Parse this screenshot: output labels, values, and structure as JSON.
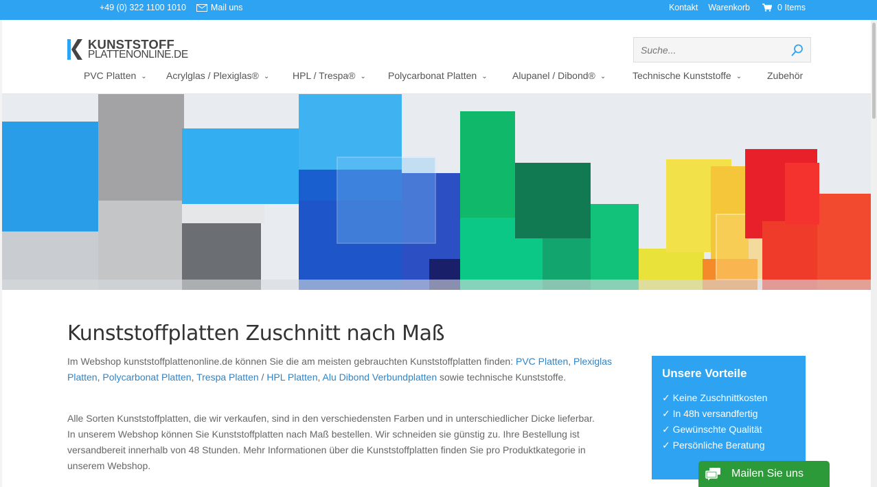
{
  "topbar": {
    "phone": "+49 (0) 322 1100 1010",
    "mail_label": "Mail uns",
    "links": [
      "Kontakt",
      "Warenkorb"
    ],
    "cart_label": "0 Items"
  },
  "logo": {
    "line1": "KUNSTSTOFF",
    "line2": "PLATTENONLINE.DE"
  },
  "search": {
    "placeholder": "Suche..."
  },
  "nav": [
    {
      "label": "PVC Platten",
      "chevron": "⌄"
    },
    {
      "label": "Acrylglas / Plexiglas®",
      "chevron": "⌄"
    },
    {
      "label": "HPL / Trespa®",
      "chevron": "⌄"
    },
    {
      "label": "Polycarbonat Platten",
      "chevron": "⌄"
    },
    {
      "label": "Alupanel / Dibond®",
      "chevron": "⌄"
    },
    {
      "label": "Technische Kunststoffe",
      "chevron": "⌄"
    },
    {
      "label": "Zubehör",
      "chevron": ""
    }
  ],
  "main": {
    "title": "Kunststoffplatten Zuschnitt nach Maß",
    "p1_intro": "Im Webshop kunststoffplattenonline.de können Sie die am meisten gebrauchten Kunststoffplatten finden: ",
    "p1_links": [
      "PVC Platten",
      "Plexiglas Platten",
      "Polycarbonat Platten",
      "Trespa Platten",
      "HPL Platten",
      "Alu Dibond Verbundplatten"
    ],
    "p1_sep_comma": ", ",
    "p1_sep_slash": " / ",
    "p1_outro": " sowie technische Kunststoffe.",
    "p2": "Alle Sorten Kunststoffplatten, die wir verkaufen, sind in den verschiedensten Farben und in unterschiedlicher Dicke lieferbar. In unserem Webshop können Sie Kunststoffplatten nach Maß bestellen. Wir schneiden sie günstig zu. Ihre Bestellung ist versandbereit innerhalb von 48 Stunden. Mehr Informationen über die Kunststoffplatten finden Sie pro Produktkategorie in unserem Webshop."
  },
  "vorteile": {
    "title": "Unsere Vorteile",
    "items": [
      "✓ Keine Zuschnittkosten",
      "✓ In 48h versandfertig",
      "✓ Gewünschte Qualität",
      "✓ Persönliche Beratung"
    ]
  },
  "mail_button": {
    "label": "Mailen Sie uns"
  },
  "colors": {
    "accent": "#2ea3f2",
    "link": "#2e84c8",
    "mail_button": "#2d9a3a"
  }
}
